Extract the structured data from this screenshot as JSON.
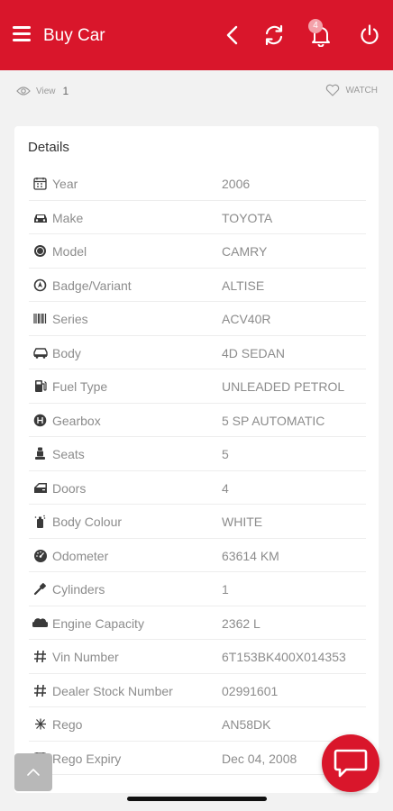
{
  "app_bar": {
    "title": "Buy Car",
    "notification_count": "4",
    "color": "#d9162b"
  },
  "listing": {
    "view_label": "View",
    "view_count": "1",
    "watch_label": "WATCH"
  },
  "details": {
    "heading": "Details",
    "rows": [
      {
        "icon": "calendar-icon",
        "label": "Year",
        "value": "2006"
      },
      {
        "icon": "car-icon",
        "label": "Make",
        "value": "TOYOTA"
      },
      {
        "icon": "model-badge-icon",
        "label": "Model",
        "value": "CAMRY"
      },
      {
        "icon": "badge-variant-icon",
        "label": "Badge/Variant",
        "value": "ALTISE"
      },
      {
        "icon": "barcode-icon",
        "label": "Series",
        "value": "ACV40R"
      },
      {
        "icon": "car-body-icon",
        "label": "Body",
        "value": "4D SEDAN"
      },
      {
        "icon": "fuel-pump-icon",
        "label": "Fuel Type",
        "value": "UNLEADED PETROL"
      },
      {
        "icon": "gearbox-icon",
        "label": "Gearbox",
        "value": "5 SP AUTOMATIC"
      },
      {
        "icon": "seat-icon",
        "label": "Seats",
        "value": "5"
      },
      {
        "icon": "car-door-icon",
        "label": "Doors",
        "value": "4"
      },
      {
        "icon": "paint-spray-icon",
        "label": "Body Colour",
        "value": "WHITE"
      },
      {
        "icon": "odometer-icon",
        "label": "Odometer",
        "value": "63614 KM"
      },
      {
        "icon": "cylinder-icon",
        "label": "Cylinders",
        "value": "1"
      },
      {
        "icon": "engine-icon",
        "label": "Engine Capacity",
        "value": "2362 L"
      },
      {
        "icon": "hash-icon",
        "label": "Vin Number",
        "value": "6T153BK400X014353"
      },
      {
        "icon": "hash-icon",
        "label": "Dealer Stock Number",
        "value": "02991601"
      },
      {
        "icon": "rego-icon",
        "label": "Rego",
        "value": "AN58DK"
      },
      {
        "icon": "calendar-icon",
        "label": "Rego Expiry",
        "value": "Dec 04, 2008"
      }
    ]
  }
}
